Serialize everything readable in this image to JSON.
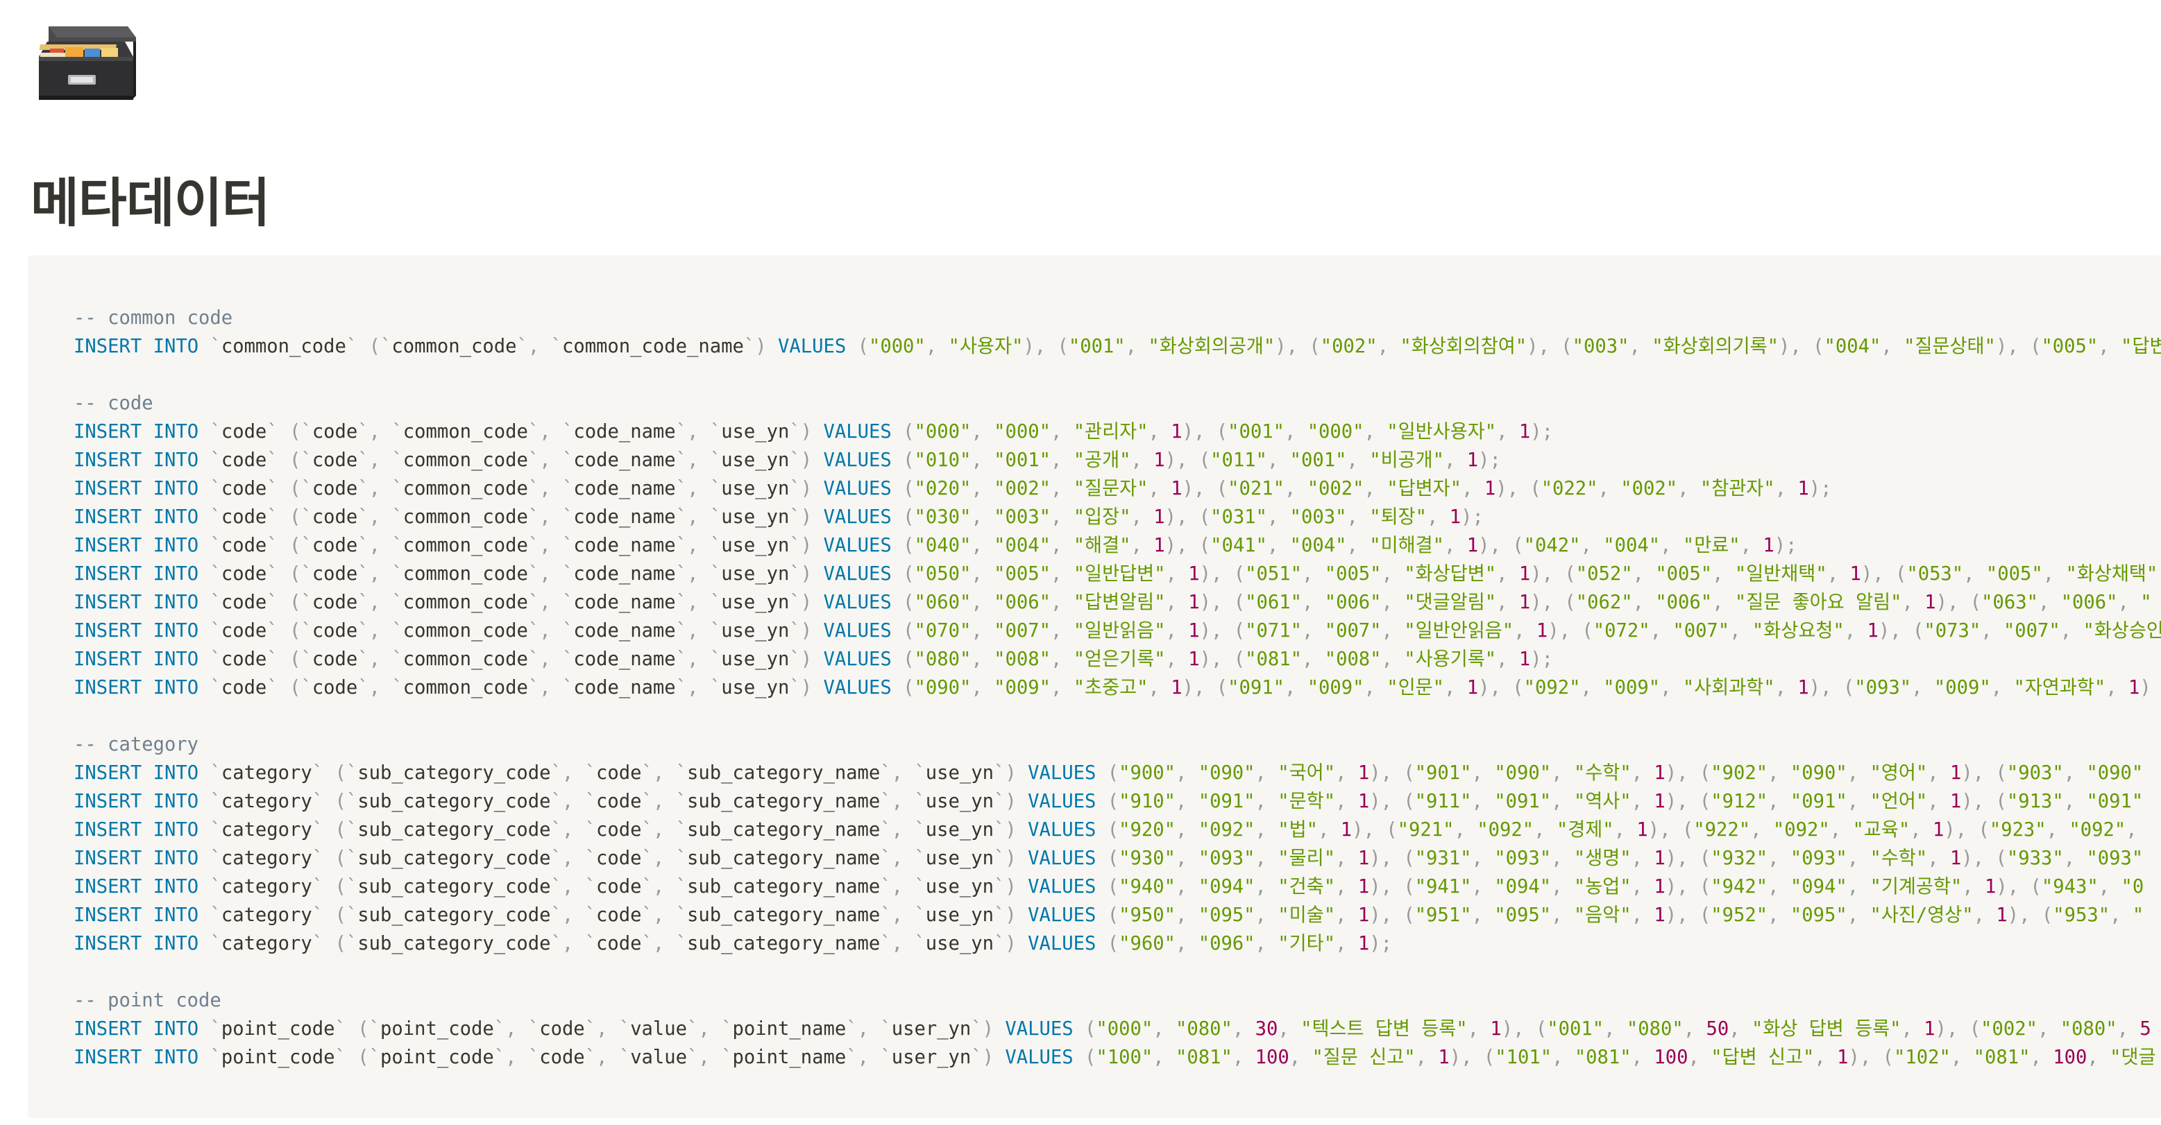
{
  "page": {
    "icon": "file-cabinet-icon",
    "title": "메타데이터"
  },
  "code_block": {
    "language": "sql",
    "lines": [
      "-- common code",
      "INSERT INTO `common_code` (`common_code`, `common_code_name`) VALUES (\"000\", \"사용자\"), (\"001\", \"화상회의공개\"), (\"002\", \"화상회의참여\"), (\"003\", \"화상회의기록\"), (\"004\", \"질문상태\"), (\"005\", \"답변",
      "",
      "-- code",
      "INSERT INTO `code` (`code`, `common_code`, `code_name`, `use_yn`) VALUES (\"000\", \"000\", \"관리자\", 1), (\"001\", \"000\", \"일반사용자\", 1);",
      "INSERT INTO `code` (`code`, `common_code`, `code_name`, `use_yn`) VALUES (\"010\", \"001\", \"공개\", 1), (\"011\", \"001\", \"비공개\", 1);",
      "INSERT INTO `code` (`code`, `common_code`, `code_name`, `use_yn`) VALUES (\"020\", \"002\", \"질문자\", 1), (\"021\", \"002\", \"답변자\", 1), (\"022\", \"002\", \"참관자\", 1);",
      "INSERT INTO `code` (`code`, `common_code`, `code_name`, `use_yn`) VALUES (\"030\", \"003\", \"입장\", 1), (\"031\", \"003\", \"퇴장\", 1);",
      "INSERT INTO `code` (`code`, `common_code`, `code_name`, `use_yn`) VALUES (\"040\", \"004\", \"해결\", 1), (\"041\", \"004\", \"미해결\", 1), (\"042\", \"004\", \"만료\", 1);",
      "INSERT INTO `code` (`code`, `common_code`, `code_name`, `use_yn`) VALUES (\"050\", \"005\", \"일반답변\", 1), (\"051\", \"005\", \"화상답변\", 1), (\"052\", \"005\", \"일반채택\", 1), (\"053\", \"005\", \"화상채택\"",
      "INSERT INTO `code` (`code`, `common_code`, `code_name`, `use_yn`) VALUES (\"060\", \"006\", \"답변알림\", 1), (\"061\", \"006\", \"댓글알림\", 1), (\"062\", \"006\", \"질문 좋아요 알림\", 1), (\"063\", \"006\", \"",
      "INSERT INTO `code` (`code`, `common_code`, `code_name`, `use_yn`) VALUES (\"070\", \"007\", \"일반읽음\", 1), (\"071\", \"007\", \"일반안읽음\", 1), (\"072\", \"007\", \"화상요청\", 1), (\"073\", \"007\", \"화상승인",
      "INSERT INTO `code` (`code`, `common_code`, `code_name`, `use_yn`) VALUES (\"080\", \"008\", \"얻은기록\", 1), (\"081\", \"008\", \"사용기록\", 1);",
      "INSERT INTO `code` (`code`, `common_code`, `code_name`, `use_yn`) VALUES (\"090\", \"009\", \"초중고\", 1), (\"091\", \"009\", \"인문\", 1), (\"092\", \"009\", \"사회과학\", 1), (\"093\", \"009\", \"자연과학\", 1)",
      "",
      "-- category",
      "INSERT INTO `category` (`sub_category_code`, `code`, `sub_category_name`, `use_yn`) VALUES (\"900\", \"090\", \"국어\", 1), (\"901\", \"090\", \"수학\", 1), (\"902\", \"090\", \"영어\", 1), (\"903\", \"090\"",
      "INSERT INTO `category` (`sub_category_code`, `code`, `sub_category_name`, `use_yn`) VALUES (\"910\", \"091\", \"문학\", 1), (\"911\", \"091\", \"역사\", 1), (\"912\", \"091\", \"언어\", 1), (\"913\", \"091\"",
      "INSERT INTO `category` (`sub_category_code`, `code`, `sub_category_name`, `use_yn`) VALUES (\"920\", \"092\", \"법\", 1), (\"921\", \"092\", \"경제\", 1), (\"922\", \"092\", \"교육\", 1), (\"923\", \"092\",",
      "INSERT INTO `category` (`sub_category_code`, `code`, `sub_category_name`, `use_yn`) VALUES (\"930\", \"093\", \"물리\", 1), (\"931\", \"093\", \"생명\", 1), (\"932\", \"093\", \"수학\", 1), (\"933\", \"093\"",
      "INSERT INTO `category` (`sub_category_code`, `code`, `sub_category_name`, `use_yn`) VALUES (\"940\", \"094\", \"건축\", 1), (\"941\", \"094\", \"농업\", 1), (\"942\", \"094\", \"기계공학\", 1), (\"943\", \"0",
      "INSERT INTO `category` (`sub_category_code`, `code`, `sub_category_name`, `use_yn`) VALUES (\"950\", \"095\", \"미술\", 1), (\"951\", \"095\", \"음악\", 1), (\"952\", \"095\", \"사진/영상\", 1), (\"953\", \"",
      "INSERT INTO `category` (`sub_category_code`, `code`, `sub_category_name`, `use_yn`) VALUES (\"960\", \"096\", \"기타\", 1);",
      "",
      "-- point code",
      "INSERT INTO `point_code` (`point_code`, `code`, `value`, `point_name`, `user_yn`) VALUES (\"000\", \"080\", 30, \"텍스트 답변 등록\", 1), (\"001\", \"080\", 50, \"화상 답변 등록\", 1), (\"002\", \"080\", 5",
      "INSERT INTO `point_code` (`point_code`, `code`, `value`, `point_name`, `user_yn`) VALUES (\"100\", \"081\", 100, \"질문 신고\", 1), (\"101\", \"081\", 100, \"답변 신고\", 1), (\"102\", \"081\", 100, \"댓글"
    ]
  },
  "colors": {
    "keyword": "#0077aa",
    "string": "#669900",
    "number": "#990055",
    "comment": "#708090",
    "punctuation": "#999999",
    "code_background": "#f7f6f3"
  }
}
